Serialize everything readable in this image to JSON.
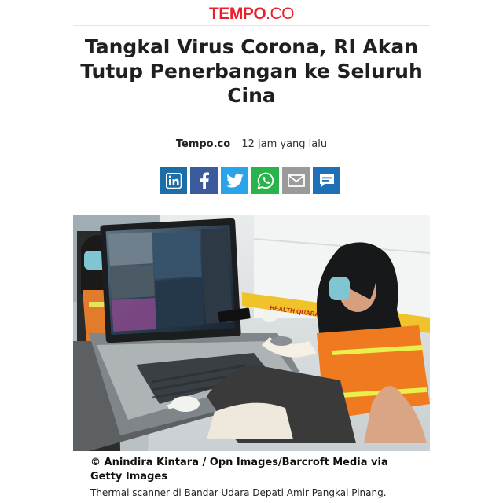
{
  "site": {
    "brand": "TEMPO",
    "tld": ".CO"
  },
  "article": {
    "title": "Tangkal Virus Corona, RI Akan Tutup Penerbangan ke Seluruh Cina",
    "source": "Tempo.co",
    "time": "12 jam yang lalu"
  },
  "share": [
    {
      "name": "linkedin-icon",
      "color": "#1b6ea8"
    },
    {
      "name": "facebook-icon",
      "color": "#3b5b9c"
    },
    {
      "name": "twitter-icon",
      "color": "#2aa3e8"
    },
    {
      "name": "whatsapp-icon",
      "color": "#28b44a"
    },
    {
      "name": "email-icon",
      "color": "#9a9a9a"
    },
    {
      "name": "comment-icon",
      "color": "#1e6fb6"
    }
  ],
  "photo": {
    "signage": "HEALTH QUARANTINE",
    "credit": "© Anindira Kintara / Opn Images/Barcroft Media via Getty Images",
    "caption": "Thermal scanner di Bandar Udara Depati Amir Pangkal Pinang."
  }
}
